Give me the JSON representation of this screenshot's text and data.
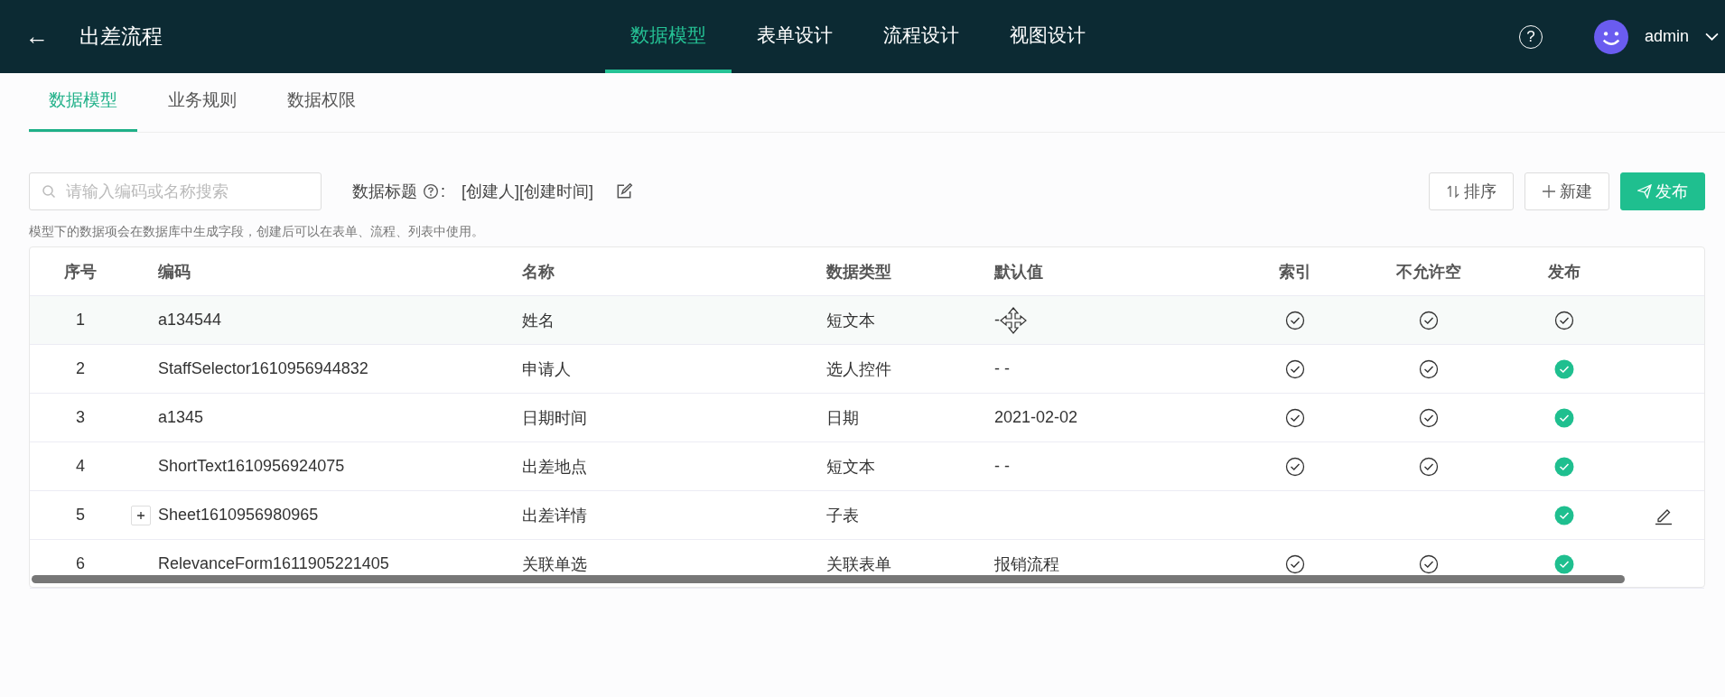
{
  "header": {
    "back": "←",
    "title": "出差流程",
    "nav": [
      {
        "label": "数据模型",
        "selected": true
      },
      {
        "label": "表单设计",
        "selected": false
      },
      {
        "label": "流程设计",
        "selected": false
      },
      {
        "label": "视图设计",
        "selected": false
      }
    ],
    "help": "?",
    "user": "admin"
  },
  "tabs": [
    {
      "label": "数据模型",
      "selected": true
    },
    {
      "label": "业务规则",
      "selected": false
    },
    {
      "label": "数据权限",
      "selected": false
    }
  ],
  "toolbar": {
    "search": {
      "placeholder": "请输入编码或名称搜索"
    },
    "data_title_label": "数据标题",
    "colon": ":",
    "data_title_value": "[创建人][创建时间]",
    "buttons": [
      {
        "label": "排序",
        "kind": "sort"
      },
      {
        "label": "新建",
        "kind": "new"
      },
      {
        "label": "发布",
        "kind": "publish"
      }
    ]
  },
  "note": "模型下的数据项会在数据库中生成字段，创建后可以在表单、流程、列表中使用。",
  "table": {
    "columns": [
      "序号",
      "编码",
      "名称",
      "数据类型",
      "默认值",
      "索引",
      "不允许空",
      "发布"
    ],
    "rows": [
      {
        "seq": "1",
        "code": "a134544",
        "name": "姓名",
        "type": "短文本",
        "default": "-",
        "index": true,
        "not_null": true,
        "published": false,
        "expandable": false,
        "editable": false,
        "hovered": true
      },
      {
        "seq": "2",
        "code": "StaffSelector1610956944832",
        "name": "申请人",
        "type": "选人控件",
        "default": "- -",
        "index": true,
        "not_null": true,
        "published": true,
        "expandable": false,
        "editable": false,
        "hovered": false
      },
      {
        "seq": "3",
        "code": "a1345",
        "name": "日期时间",
        "type": "日期",
        "default": "2021-02-02",
        "index": true,
        "not_null": true,
        "published": true,
        "expandable": false,
        "editable": false,
        "hovered": false
      },
      {
        "seq": "4",
        "code": "ShortText1610956924075",
        "name": "出差地点",
        "type": "短文本",
        "default": "- -",
        "index": true,
        "not_null": true,
        "published": true,
        "expandable": false,
        "editable": false,
        "hovered": false
      },
      {
        "seq": "5",
        "code": "Sheet1610956980965",
        "name": "出差详情",
        "type": "子表",
        "index": false,
        "not_null": false,
        "published": true,
        "expandable": true,
        "editable": true,
        "hovered": false
      },
      {
        "seq": "6",
        "code": "RelevanceForm1611905221405",
        "name": "关联单选",
        "type": "关联表单",
        "default": "报销流程",
        "index": true,
        "not_null": true,
        "published": true,
        "expandable": false,
        "editable": false,
        "hovered": false
      }
    ]
  }
}
